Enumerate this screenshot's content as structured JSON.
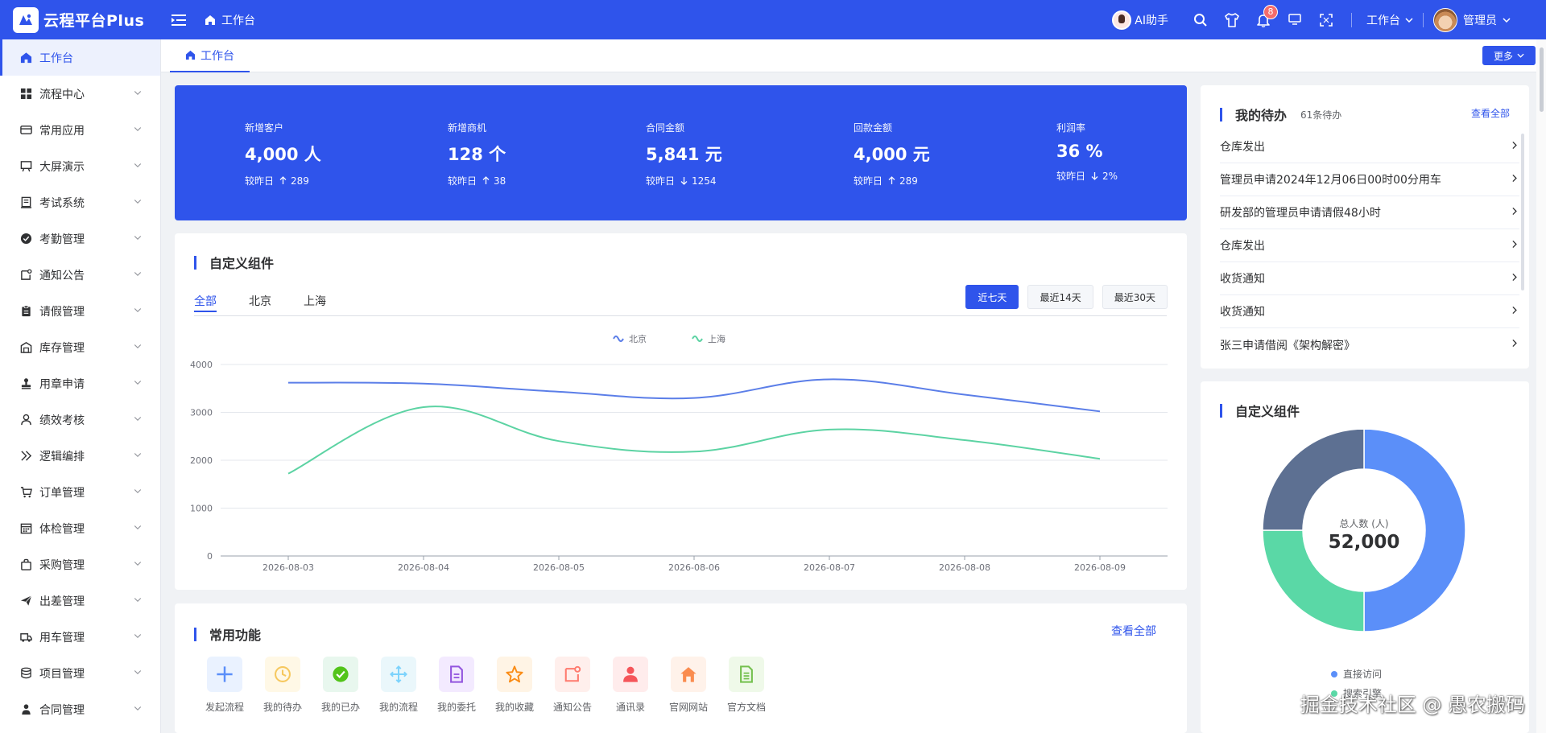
{
  "app": {
    "name": "云程平台Plus"
  },
  "header": {
    "breadcrumb": "工作台",
    "ai_helper": "AI助手",
    "notification_count": "8",
    "workspace_select": "工作台",
    "user_name": "管理员",
    "tools": [
      "search-icon",
      "shirt-icon",
      "bell-icon",
      "monitor-icon",
      "fullscreen-icon"
    ]
  },
  "sidebar": {
    "items": [
      {
        "label": "工作台",
        "icon": "home-icon",
        "active": true
      },
      {
        "label": "流程中心",
        "icon": "grid-icon"
      },
      {
        "label": "常用应用",
        "icon": "card-icon"
      },
      {
        "label": "大屏演示",
        "icon": "board-icon"
      },
      {
        "label": "考试系统",
        "icon": "exam-icon"
      },
      {
        "label": "考勤管理",
        "icon": "check-circle-icon"
      },
      {
        "label": "通知公告",
        "icon": "notice-icon"
      },
      {
        "label": "请假管理",
        "icon": "clipboard-icon"
      },
      {
        "label": "库存管理",
        "icon": "warehouse-icon"
      },
      {
        "label": "用章申请",
        "icon": "stamp-icon"
      },
      {
        "label": "绩效考核",
        "icon": "user-icon"
      },
      {
        "label": "逻辑编排",
        "icon": "double-chevron-icon"
      },
      {
        "label": "订单管理",
        "icon": "cart-icon"
      },
      {
        "label": "体检管理",
        "icon": "calendar-icon"
      },
      {
        "label": "采购管理",
        "icon": "bag-icon"
      },
      {
        "label": "出差管理",
        "icon": "plane-icon"
      },
      {
        "label": "用车管理",
        "icon": "truck-icon"
      },
      {
        "label": "项目管理",
        "icon": "database-icon"
      },
      {
        "label": "合同管理",
        "icon": "person-icon"
      }
    ]
  },
  "tabs": {
    "active": "工作台",
    "more": "更多"
  },
  "stats": [
    {
      "label": "新增客户",
      "value": "4,000 人",
      "compare": "较昨日",
      "trend": "up",
      "delta": "289"
    },
    {
      "label": "新增商机",
      "value": "128 个",
      "compare": "较昨日",
      "trend": "up",
      "delta": "38"
    },
    {
      "label": "合同金额",
      "value": "5,841 元",
      "compare": "较昨日",
      "trend": "down",
      "delta": "1254"
    },
    {
      "label": "回款金额",
      "value": "4,000 元",
      "compare": "较昨日",
      "trend": "up",
      "delta": "289"
    },
    {
      "label": "利润率",
      "value": "36 %",
      "compare": "较昨日",
      "trend": "down",
      "delta": "2%"
    }
  ],
  "custom_chart": {
    "title": "自定义组件",
    "filters": [
      "全部",
      "北京",
      "上海"
    ],
    "active_filter": "全部",
    "ranges": [
      "近七天",
      "最近14天",
      "最近30天"
    ],
    "active_range": "近七天"
  },
  "chart_data": {
    "type": "line",
    "x": [
      "2026-08-03",
      "2026-08-04",
      "2026-08-05",
      "2026-08-06",
      "2026-08-07",
      "2026-08-08",
      "2026-08-09"
    ],
    "series": [
      {
        "name": "北京",
        "values": [
          3620,
          3600,
          3430,
          3300,
          3690,
          3370,
          3020
        ],
        "color": "#5b7ee8"
      },
      {
        "name": "上海",
        "values": [
          1720,
          3110,
          2400,
          2180,
          2640,
          2420,
          2030
        ],
        "color": "#5cd3a3"
      }
    ],
    "ylim": [
      0,
      4000
    ],
    "yticks": [
      0,
      1000,
      2000,
      3000,
      4000
    ],
    "legend": "top-center",
    "grid": true,
    "smooth": true
  },
  "todo": {
    "title": "我的待办",
    "count": "61条待办",
    "view_all": "查看全部",
    "items": [
      "仓库发出",
      "管理员申请2024年12月06日00时00分用车",
      "研发部的管理员申请请假48小时",
      "仓库发出",
      "收货通知",
      "收货通知",
      "张三申请借阅《架构解密》"
    ]
  },
  "donut": {
    "title": "自定义组件",
    "center_label": "总人数 (人)",
    "center_value": "52,000",
    "slices": [
      {
        "name": "直接访问",
        "value": 50,
        "color": "#5b8ff9"
      },
      {
        "name": "搜索引擎",
        "value": 25,
        "color": "#5ad8a6"
      },
      {
        "name": "",
        "value": 25,
        "color": "#5d7092"
      }
    ]
  },
  "shortcuts": {
    "title": "常用功能",
    "view_all": "查看全部",
    "items": [
      {
        "label": "发起流程",
        "icon": "plus-icon",
        "color": "#5b8ff9",
        "bg": "#eaf2ff"
      },
      {
        "label": "我的待办",
        "icon": "clock-icon",
        "color": "#f6c85f",
        "bg": "#fff8e6"
      },
      {
        "label": "我的已办",
        "icon": "check-circle-icon",
        "color": "#52c41a",
        "bg": "#e8f7ee"
      },
      {
        "label": "我的流程",
        "icon": "move-icon",
        "color": "#7dd3fc",
        "bg": "#eaf7fb"
      },
      {
        "label": "我的委托",
        "icon": "document-icon",
        "color": "#9254de",
        "bg": "#f3eaff"
      },
      {
        "label": "我的收藏",
        "icon": "star-icon",
        "color": "#fa8c16",
        "bg": "#fff4e5"
      },
      {
        "label": "通知公告",
        "icon": "notice-icon",
        "color": "#ff7a6e",
        "bg": "#ffefec"
      },
      {
        "label": "通讯录",
        "icon": "contact-icon",
        "color": "#f5555a",
        "bg": "#ffecec"
      },
      {
        "label": "官网网站",
        "icon": "house-icon",
        "color": "#fa8c4f",
        "bg": "#fff2ea"
      },
      {
        "label": "官方文档",
        "icon": "doc-icon",
        "color": "#73c04d",
        "bg": "#eff9e9"
      }
    ]
  },
  "watermark": "掘金技术社区 @ 愚农搬码"
}
